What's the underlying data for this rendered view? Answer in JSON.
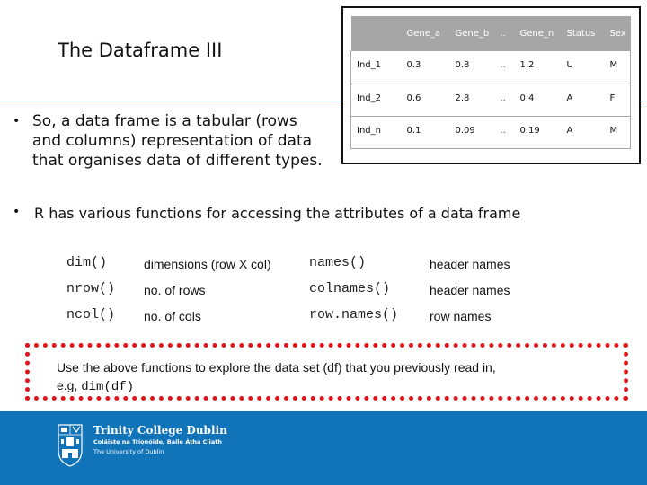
{
  "slide": {
    "title": "The Dataframe III",
    "bullet_symbol": "•",
    "intro_bullet": "So, a data frame is a tabular (rows and columns) representation of data that organises data of different types.",
    "functions_bullet": "R has various functions for accessing the attributes of a data frame"
  },
  "table": {
    "headers": [
      "",
      "Gene_a",
      "Gene_b",
      "..",
      "Gene_n",
      "Status",
      "Sex"
    ],
    "rows": [
      [
        "Ind_1",
        "0.3",
        "0.8",
        "..",
        "1.2",
        "U",
        "M"
      ],
      [
        "Ind_2",
        "0.6",
        "2.8",
        "..",
        "0.4",
        "A",
        "F"
      ],
      [
        "Ind_n",
        "0.1",
        "0.09",
        "..",
        "0.19",
        "A",
        "M"
      ]
    ]
  },
  "functions": [
    {
      "code": "dim()",
      "desc": "dimensions (row X col)",
      "code2": "names()",
      "desc2": "header names"
    },
    {
      "code": "nrow()",
      "desc": "no. of rows",
      "code2": "colnames()",
      "desc2": "header names"
    },
    {
      "code": "ncol()",
      "desc": "no. of cols",
      "code2": "row.names()",
      "desc2": "row names"
    }
  ],
  "note": {
    "line1": "Use the above functions to explore the data set (df) that you previously read in,",
    "line2_prefix": "e.g, ",
    "line2_code": "dim(df)",
    "border_color": "#e0151b"
  },
  "footer": {
    "background": "#1173b8",
    "institution": "Trinity College Dublin",
    "irish_name": "Coláiste na Tríonóide, Baile Átha Cliath",
    "subtitle": "The University of Dublin",
    "crest_icon": "trinity-crest-icon"
  }
}
